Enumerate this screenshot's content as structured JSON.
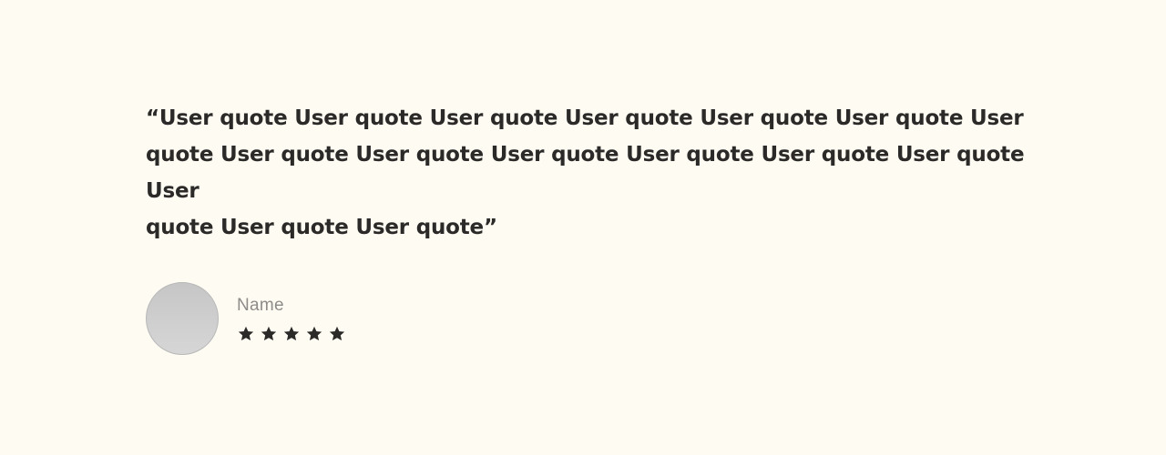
{
  "testimonial": {
    "quote": "“User quote User quote User quote User quote User quote User quote User\nquote User quote User quote User quote User quote User quote User quote User\nquote User quote User quote”"
  },
  "author": {
    "name": "Name",
    "avatar_icon": "avatar-placeholder",
    "rating": 5,
    "rating_max": 5,
    "star_icon": "star-icon",
    "star_color": "#2b2a28"
  },
  "colors": {
    "background": "#fdfbf2",
    "text": "#2b2a28",
    "muted": "#8e8c89"
  }
}
